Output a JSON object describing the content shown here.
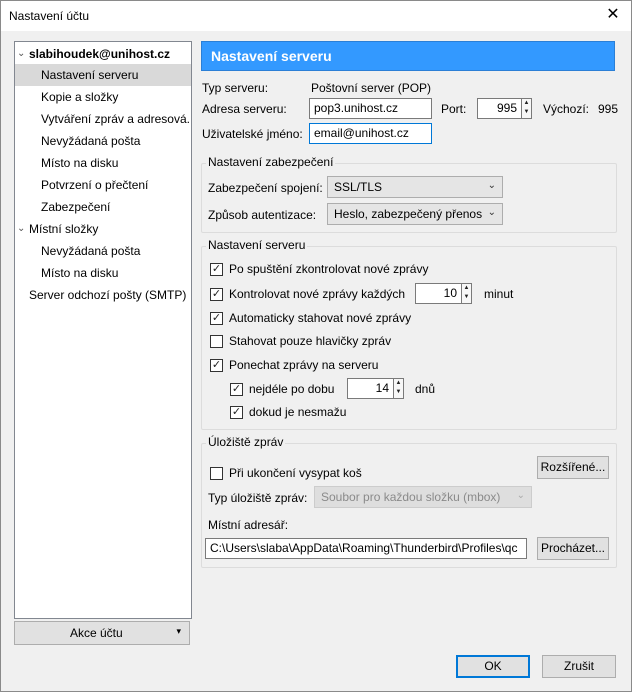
{
  "window": {
    "title": "Nastavení účtu",
    "close_glyph": "✕"
  },
  "tree": {
    "account": "slabihoudek@unihost.cz",
    "account_items": [
      "Nastavení serveru",
      "Kopie a složky",
      "Vytváření zpráv a adresová...",
      "Nevyžádaná pošta",
      "Místo na disku",
      "Potvrzení o přečtení",
      "Zabezpečení"
    ],
    "local": "Místní složky",
    "local_items": [
      "Nevyžádaná pošta",
      "Místo na disku"
    ],
    "smtp": "Server odchozí pošty (SMTP)",
    "expand_glyph": "⌄"
  },
  "actions_button": {
    "label": "Akce účtu",
    "arrow": "▾"
  },
  "header": "Nastavení serveru",
  "server": {
    "type_label": "Typ serveru:",
    "type_value": "Poštovní server (POP)",
    "address_label": "Adresa serveru:",
    "address_value": "pop3.unihost.cz",
    "port_label": "Port:",
    "port_value": "995",
    "default_label": "Výchozí:",
    "default_value": "995",
    "username_label": "Uživatelské jméno:",
    "username_value": "email@unihost.cz"
  },
  "security": {
    "legend": "Nastavení zabezpečení",
    "connection_label": "Zabezpečení spojení:",
    "connection_value": "SSL/TLS",
    "auth_label": "Způsob autentizace:",
    "auth_value": "Heslo, zabezpečený přenos"
  },
  "server_settings": {
    "legend": "Nastavení serveru",
    "check_startup": "Po spuštění zkontrolovat nové zprávy",
    "check_every": "Kontrolovat nové zprávy každých",
    "check_every_value": "10",
    "minutes": "minut",
    "auto_download": "Automaticky stahovat nové zprávy",
    "headers_only": "Stahovat pouze hlavičky zpráv",
    "leave_on_server": "Ponechat zprávy na serveru",
    "at_most": "nejdéle po dobu",
    "at_most_value": "14",
    "days": "dnů",
    "until_deleted": "dokud je nesmažu"
  },
  "storage": {
    "legend": "Úložiště zpráv",
    "empty_trash": "Při ukončení vysypat koš",
    "advanced": "Rozšířené...",
    "store_type_label": "Typ úložiště zpráv:",
    "store_type_value": "Soubor pro každou složku (mbox)",
    "local_dir_label": "Místní adresář:",
    "local_dir_value": "C:\\Users\\slaba\\AppData\\Roaming\\Thunderbird\\Profiles\\qc",
    "browse": "Procházet..."
  },
  "buttons": {
    "ok": "OK",
    "cancel": "Zrušit"
  },
  "checkbox_glyph": "✓",
  "spin_up": "▲",
  "spin_down": "▼",
  "combo_arrow": "⌄"
}
